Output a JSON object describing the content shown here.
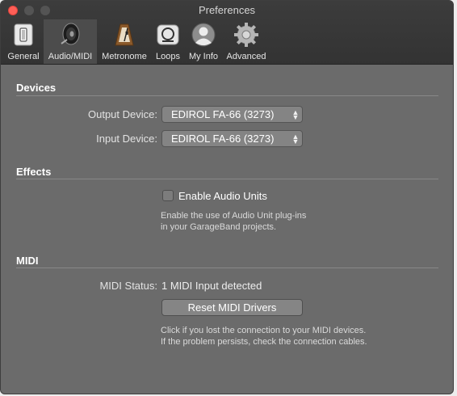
{
  "window": {
    "title": "Preferences"
  },
  "toolbar": {
    "tabs": [
      {
        "label": "General",
        "icon": "general-icon"
      },
      {
        "label": "Audio/MIDI",
        "icon": "speaker-icon"
      },
      {
        "label": "Metronome",
        "icon": "metronome-icon"
      },
      {
        "label": "Loops",
        "icon": "loops-icon"
      },
      {
        "label": "My Info",
        "icon": "user-icon"
      },
      {
        "label": "Advanced",
        "icon": "gear-icon"
      }
    ],
    "selected": "Audio/MIDI"
  },
  "devices": {
    "title": "Devices",
    "output_label": "Output Device:",
    "output_value": "EDIROL FA-66 (3273)",
    "input_label": "Input Device:",
    "input_value": "EDIROL FA-66 (3273)"
  },
  "effects": {
    "title": "Effects",
    "checkbox_label": "Enable Audio Units",
    "checkbox_checked": false,
    "help_line1": "Enable the use of Audio Unit plug-ins",
    "help_line2": "in your GarageBand projects."
  },
  "midi": {
    "title": "MIDI",
    "status_label": "MIDI Status:",
    "status_value": "1 MIDI Input detected",
    "reset_button": "Reset MIDI Drivers",
    "help_line1": "Click if you lost the connection to your MIDI devices.",
    "help_line2": "If the problem persists, check the connection cables."
  },
  "colors": {
    "window_bg": "#6b6b6b",
    "titlebar_bg": "#3a3a3a",
    "close_button": "#ff5f57"
  }
}
